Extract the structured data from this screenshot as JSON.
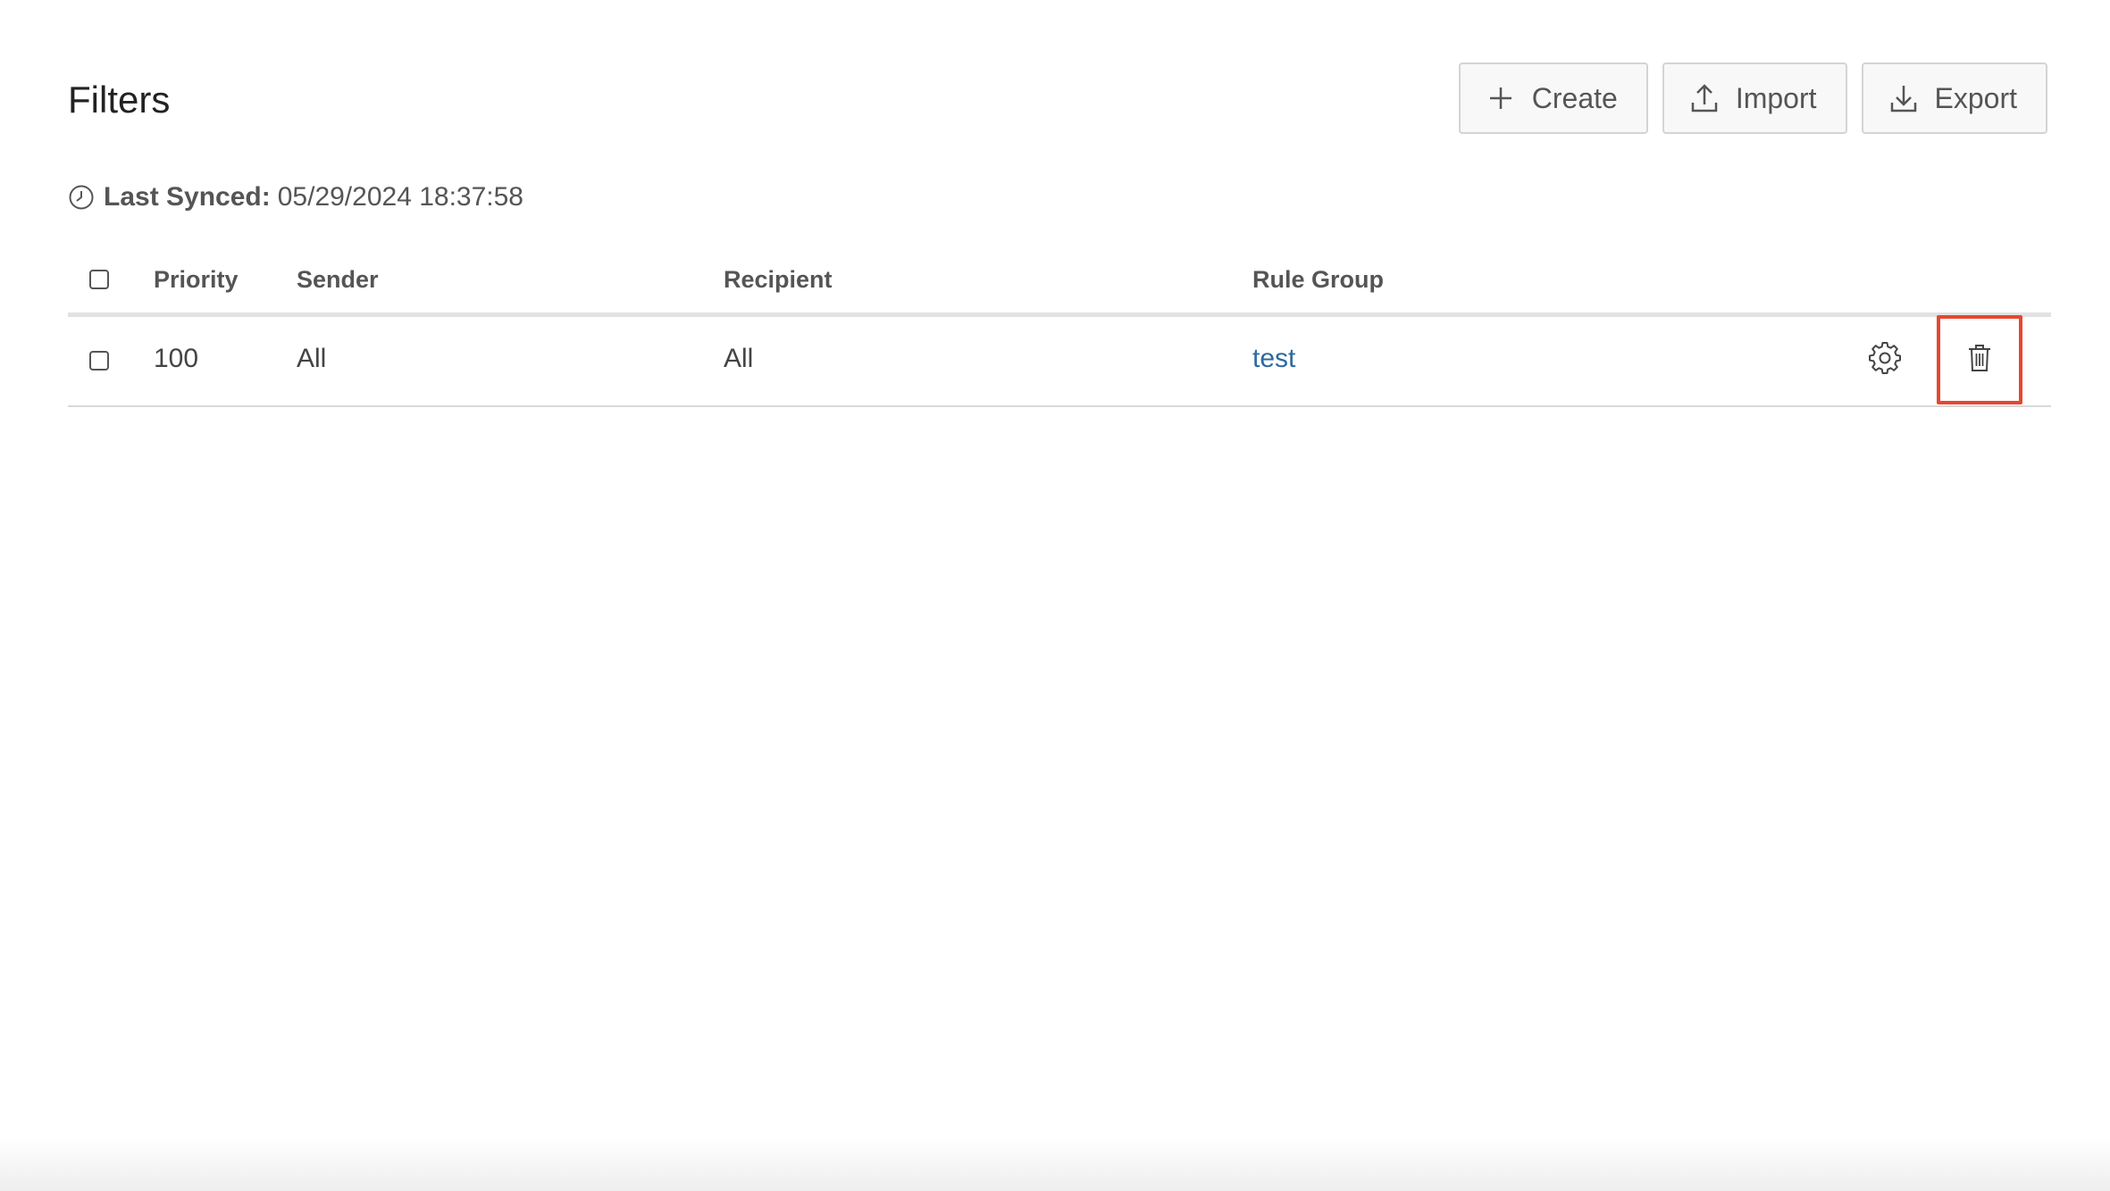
{
  "page": {
    "title": "Filters"
  },
  "toolbar": {
    "create_label": "Create",
    "import_label": "Import",
    "export_label": "Export",
    "create_icon": "plus-icon",
    "import_icon": "upload-icon",
    "export_icon": "download-icon"
  },
  "sync": {
    "label": "Last Synced:",
    "value": "05/29/2024 18:37:58",
    "icon": "clock-icon"
  },
  "table": {
    "columns": [
      "Priority",
      "Sender",
      "Recipient",
      "Rule Group"
    ],
    "rows": [
      {
        "priority": "100",
        "sender": "All",
        "recipient": "All",
        "rule_group": "test",
        "actions": [
          "gear-icon",
          "trash-icon"
        ]
      }
    ]
  },
  "colors": {
    "link": "#2c6aa0",
    "highlight": "#e8462f"
  }
}
